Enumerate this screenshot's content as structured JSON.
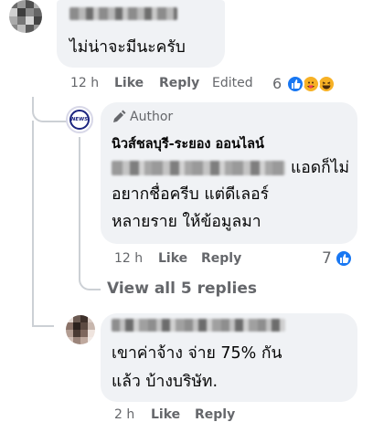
{
  "comment1": {
    "text": "ไม่น่าจะมีนะครับ",
    "time": "12 h",
    "like": "Like",
    "reply": "Reply",
    "edited": "Edited",
    "reaction_count": "6",
    "reactions": [
      "like-icon",
      "love-care-icon",
      "haha-icon"
    ]
  },
  "author_reply": {
    "badge": "Author",
    "avatar_text": "NEWS",
    "page_name": "นิวส์ชลบุรี-ระยอง ออนไลน์",
    "line1_suffix": "แอดก็ไม่",
    "line2": "อยากชื่อครีบ แต่ดีเลอร์",
    "line3": "หลายราย ให้ข้อมูลมา",
    "time": "12 h",
    "like": "Like",
    "reply": "Reply",
    "reaction_count": "7",
    "reaction_icon": "like-icon"
  },
  "view_replies": "View all 5 replies",
  "comment2": {
    "line1": "เขาค่าจ้าง จ่าย 75% กัน",
    "line2": "แล้ว บ้างบริษัท.",
    "time": "2 h",
    "like": "Like",
    "reply": "Reply"
  },
  "colors": {
    "bubble": "#f0f2f5",
    "meta": "#65676b",
    "fb_blue": "#1877f2",
    "thread_line": "#ccd0d5"
  }
}
